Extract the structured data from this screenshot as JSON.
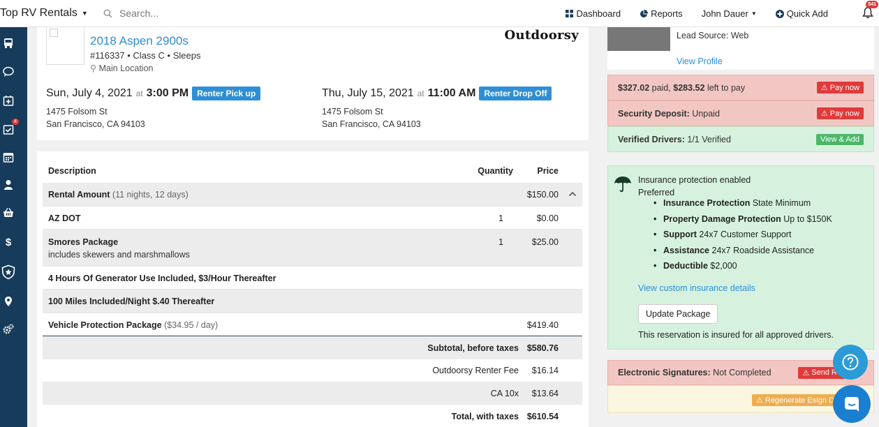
{
  "header": {
    "brand": "Top RV Rentals",
    "search_placeholder": "Search...",
    "nav": {
      "dashboard": "Dashboard",
      "reports": "Reports",
      "user": "John Dauer",
      "quick_add": "Quick Add"
    },
    "notification_count": "541"
  },
  "sidebar": {
    "items": [
      "bus-icon",
      "chat-icon",
      "calendar-plus-icon",
      "calendar-check-icon",
      "calendar-icon",
      "user-icon",
      "basket-icon",
      "dollar-icon",
      "shield-icon",
      "map-pin-icon",
      "gears-icon"
    ],
    "tasks_badge": "4"
  },
  "vehicle": {
    "title": "2018 Aspen 2900s",
    "subtitle": "#116337 • Class C • Sleeps",
    "location": "Main Location",
    "brand_logo": "Outdoorsy"
  },
  "pickup": {
    "date": "Sun, July 4, 2021",
    "at": "at",
    "time": "3:00 PM",
    "label": "Renter Pick up",
    "address_line1": "1475 Folsom St",
    "address_line2": "San Francisco, CA 94103"
  },
  "dropoff": {
    "date": "Thu, July 15, 2021",
    "at": "at",
    "time": "11:00 AM",
    "label": "Renter Drop Off",
    "address_line1": "1475 Folsom St",
    "address_line2": "San Francisco, CA 94103"
  },
  "pricing": {
    "columns": {
      "description": "Description",
      "quantity": "Quantity",
      "price": "Price"
    },
    "rows": [
      {
        "desc": "Rental Amount",
        "muted": "(11 nights, 12 days)",
        "qty": "",
        "price": "$150.00"
      },
      {
        "desc": "AZ DOT",
        "muted": "",
        "qty": "1",
        "price": "$0.00"
      },
      {
        "desc": "Smores Package",
        "note": "includes skewers and marshmallows",
        "qty": "1",
        "price": "$25.00"
      },
      {
        "desc": "4 Hours Of Generator Use Included, $3/Hour Thereafter",
        "qty": "",
        "price": ""
      },
      {
        "desc": "100 Miles Included/Night $.40 Thereafter",
        "qty": "",
        "price": ""
      },
      {
        "desc": "Vehicle Protection Package",
        "muted": "($34.95 / day)",
        "qty": "",
        "price": "$419.40"
      }
    ],
    "totals": [
      {
        "label": "Subtotal, before taxes",
        "value": "$580.76"
      },
      {
        "label": "Outdoorsy Renter Fee",
        "value": "$16.14"
      },
      {
        "label": "CA 10x",
        "value": "$13.64"
      },
      {
        "label": "Total, with taxes",
        "value": "$610.54"
      }
    ]
  },
  "renter": {
    "lead_source": "Lead Source: Web",
    "view_profile": "View Profile"
  },
  "payment": {
    "paid": "$327.02",
    "paid_word": "paid,",
    "left": "$283.52",
    "left_word": "left to pay",
    "pay_now": "Pay now"
  },
  "deposit": {
    "label": "Security Deposit:",
    "status": "Unpaid",
    "pay_now": "Pay now"
  },
  "drivers": {
    "label": "Verified Drivers:",
    "status": "1/1 Verified",
    "button": "View & Add"
  },
  "insurance": {
    "title": "Insurance protection enabled",
    "plan": "Preferred",
    "items": [
      {
        "name": "Insurance Protection",
        "value": "State Minimum"
      },
      {
        "name": "Property Damage Protection",
        "value": "Up to $150K"
      },
      {
        "name": "Support",
        "value": "24x7 Customer Support"
      },
      {
        "name": "Assistance",
        "value": "24x7 Roadside Assistance"
      },
      {
        "name": "Deductible",
        "value": "$2,000"
      }
    ],
    "details_link": "View custom insurance details",
    "update_button": "Update Package",
    "footer": "This reservation is insured for all approved drivers."
  },
  "esign": {
    "label": "Electronic Signatures:",
    "status": "Not Completed",
    "send_button": "Send Re",
    "regenerate_button": "Regenerate Esign Do"
  },
  "colors": {
    "accent": "#2a8ed8",
    "sidebar": "#173b5a",
    "danger": "#e03a3a",
    "success": "#4cb76b",
    "warning": "#f0ad4e"
  }
}
